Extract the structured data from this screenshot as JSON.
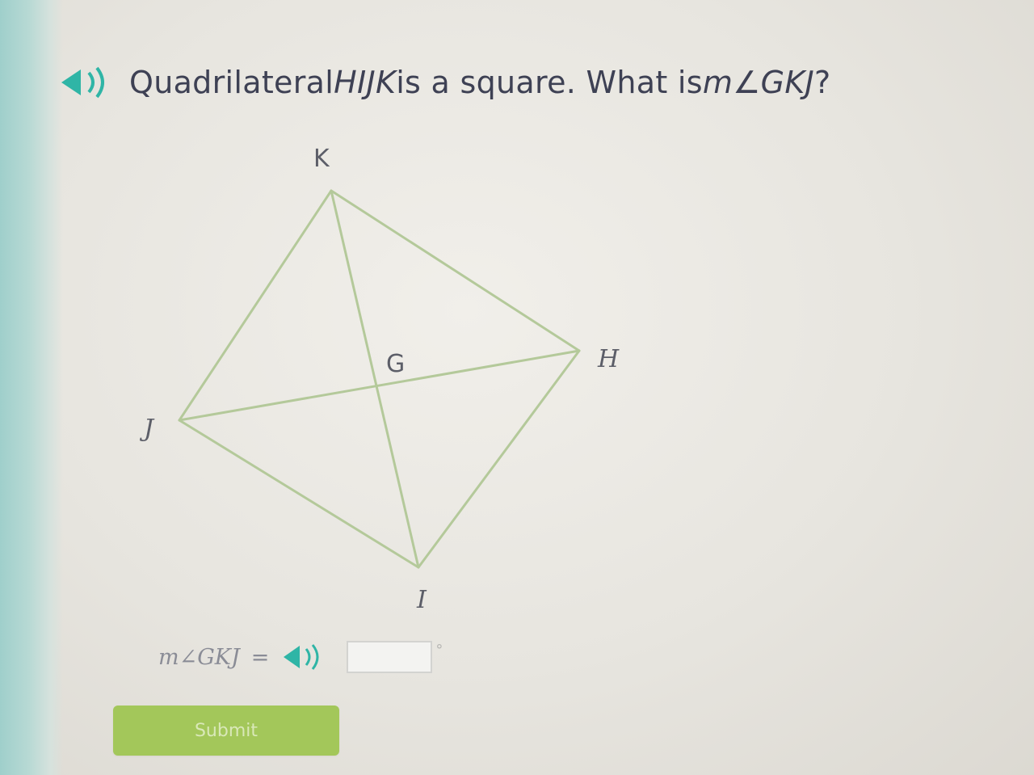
{
  "question": {
    "prefix": "Quadrilateral ",
    "shape_name": "HIJK",
    "middle": " is a square. What is ",
    "measure": "m∠GKJ",
    "suffix": "?"
  },
  "icons": {
    "question_audio": "speaker-icon",
    "answer_audio": "speaker-icon"
  },
  "figure": {
    "labels": {
      "K": "K",
      "H": "H",
      "J": "J",
      "I": "I",
      "G": "G"
    }
  },
  "answer": {
    "label": "m∠GKJ",
    "equals": "=",
    "value": "",
    "unit": "°"
  },
  "submit": {
    "label": "Submit"
  },
  "colors": {
    "figure_line": "#b4c99a",
    "accent_teal": "#2fb5a6",
    "submit_green": "#a3c75a"
  }
}
